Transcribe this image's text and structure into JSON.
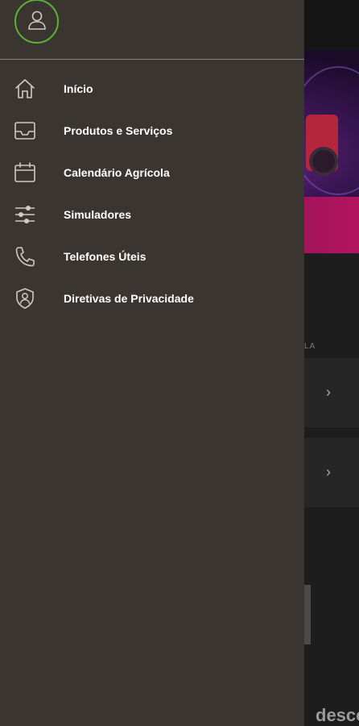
{
  "drawer": {
    "items": [
      {
        "label": "Início",
        "icon": "home-icon"
      },
      {
        "label": "Produtos e Serviços",
        "icon": "inbox-icon"
      },
      {
        "label": "Calendário Agrícola",
        "icon": "calendar-icon"
      },
      {
        "label": "Simuladores",
        "icon": "sliders-icon"
      },
      {
        "label": "Telefones Úteis",
        "icon": "phone-icon"
      },
      {
        "label": "Diretivas de Privacidade",
        "icon": "shield-user-icon"
      }
    ]
  },
  "background": {
    "section_label": "LA",
    "brand_fragment": "desco"
  },
  "colors": {
    "drawer_bg": "#3b3531",
    "avatar_ring": "#5cb135",
    "text": "#ffffff"
  }
}
